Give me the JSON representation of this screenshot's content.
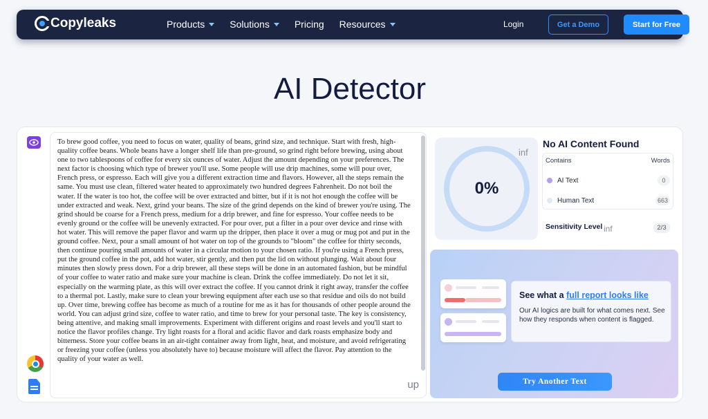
{
  "nav": {
    "logo": "Copyleaks",
    "links": [
      "Products",
      "Solutions",
      "Pricing",
      "Resources"
    ],
    "login": "Login",
    "demo": "Get a Demo",
    "start": "Start for Free"
  },
  "page_title": "AI Detector",
  "input": {
    "text": "To brew good coffee, you need to focus on water, quality of beans, grind size, and technique. Start with fresh, high-quality coffee beans. Whole beans have a longer shelf life than pre-ground, so grind right before brewing, using about one to two tablespoons of coffee for every six ounces of water. Adjust the amount depending on your preferences. The next factor is choosing which type of brewer you'll use. Some people will use drip machines, some will pour over, French press, or espresso. Each will give you a different extraction time and flavors. However, all the steps remain the same. You must use clean, filtered water heated to approximately two hundred degrees Fahrenheit. Do not boil the water. If the water is too hot, the coffee will be over extracted and bitter, but if it is not hot enough the coffee will be under extracted and weak. Next, grind your beans. The size of the grind depends on the kind of brewer you're using. The grind should be coarse for a French press, medium for a drip brewer, and fine for espresso. Your coffee needs to be evenly ground or the coffee will be unevenly extracted. For pour over, put a filter in a pour over device and rinse with hot water. This will remove the paper flavor and warm up the dripper, then place it over a mug or mug pot and put in the ground coffee. Next, pour a small amount of hot water on top of the grounds to \"bloom\" the coffee for thirty seconds, then continue pouring small amounts of water in a circular motion to your chosen ratio. If you're using a French press, put the ground coffee in the pot, add hot water, stir gently, and then put the lid on without plunging. Wait about four minutes then slowly press down. For a drip brewer, all these steps will be done in an automated fashion, but be mindful of your coffee to water ratio and make sure your machine is clean. Drink the coffee immediately. Do not let it sit, especially on the warming plate, as this will over extract the coffee. If you cannot drink it right away, transfer the coffee to a thermal pot. Lastly, make sure to clean your brewing equipment after each use so that residue and oils do not build up. Over time, brewing coffee has become as much of a routine for me as it has for thousands of other people around the world. You can adjust grind size, coffee to water ratio, and time to brew for your personal taste. The key is consistency, being attentive, and making small improvements. Experiment with different origins and roast levels and you'll start to notice the flavor profiles change. Try light roasts for a floral and acidic flavor and dark roasts emphasize body and bitterness. Store your coffee beans in an air-tight container away from light, heat, and moisture, and avoid refrigerating or freezing your coffee (unless you absolutely have to) because moisture will affect the flavor. Pay attention to the quality of your water as well.",
    "corner_label": "up"
  },
  "result": {
    "percent": "0%",
    "gauge_label": "inf",
    "headline": "No AI Content Found",
    "table": {
      "col_contains": "Contains",
      "col_words": "Words",
      "rows": [
        {
          "label": "AI Text",
          "words": "0",
          "color": "#b79cf0"
        },
        {
          "label": "Human Text",
          "words": "663",
          "color": "#dce9fb"
        }
      ]
    },
    "sensitivity_label": "Sensitivity Level",
    "sensitivity_inf": "inf",
    "sensitivity_value": "2/3"
  },
  "promo": {
    "title_prefix": "See what a",
    "title_link": "full report looks like",
    "body": "Our AI logics are built for what comes next. See how they responds when content is flagged.",
    "button": "Try Another Text"
  },
  "colors": {
    "accent": "#1f8bff",
    "nav_bg": "#1b2440",
    "ai_purple": "#7b3fe4"
  },
  "icons": [
    "eye-icon",
    "chrome-icon",
    "document-icon"
  ]
}
